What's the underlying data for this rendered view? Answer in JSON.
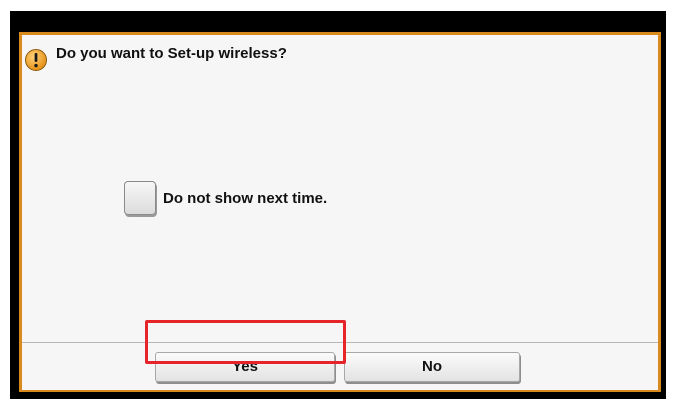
{
  "dialog": {
    "icon": "warning-icon",
    "title": "Do you want to Set-up wireless?",
    "checkbox": {
      "label": "Do not show next time.",
      "checked": false
    },
    "buttons": {
      "yes_label": "Yes",
      "no_label": "No"
    },
    "colors": {
      "border": "#d98a1c",
      "warning": "#f2a52c",
      "highlight": "#e5252a"
    }
  }
}
